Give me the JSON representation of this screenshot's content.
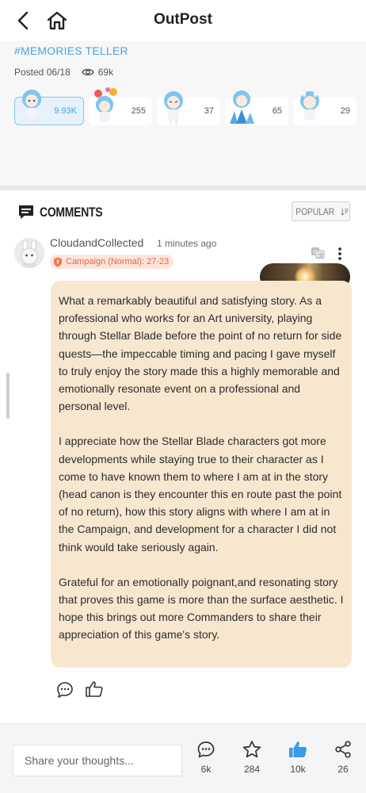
{
  "header": {
    "title": "OutPost"
  },
  "post": {
    "hashtag": "#MEMORIES TELLER",
    "posted": "Posted 06/18",
    "views": "69k"
  },
  "reactions": [
    {
      "count": "9.93K",
      "active": true
    },
    {
      "count": "255",
      "active": false
    },
    {
      "count": "37",
      "active": false
    },
    {
      "count": "65",
      "active": false
    },
    {
      "count": "29",
      "active": false
    }
  ],
  "comments_section": {
    "title": "COMMENTS",
    "sort_label": "POPULAR"
  },
  "comment": {
    "username": "CloudandCollected",
    "time": "1 minutes ago",
    "badge": "Campaign (Normal): 27-23",
    "paragraphs": [
      "What a remarkably beautiful and satisfying story. As a professional who works for an Art university, playing through Stellar Blade before the point of no return for side quests—the impeccable timing and pacing I gave myself to truly enjoy the story made this a highly memorable and emotionally resonate event on a professional and personal level.",
      "I appreciate how the Stellar Blade characters got more developments while staying true to their character as I come to have known them to where I am at in the story (head canon is they encounter this en route past the point of no return), how this story aligns with where I am at in the Campaign, and development for a character I did not think would take seriously again.",
      "Grateful for an emotionally poignant,and resonating story that proves this game is more than the surface aesthetic. I hope this brings out more Commanders to share their appreciation of this game's story."
    ]
  },
  "bottom_bar": {
    "placeholder": "Share your thoughts...",
    "comments_count": "6k",
    "favorites_count": "284",
    "likes_count": "10k",
    "shares_count": "26"
  },
  "colors": {
    "accent": "#4aa3df",
    "bubble": "#f8e7cf",
    "badge_text": "#e2683e",
    "like_active": "#3a9be8"
  }
}
